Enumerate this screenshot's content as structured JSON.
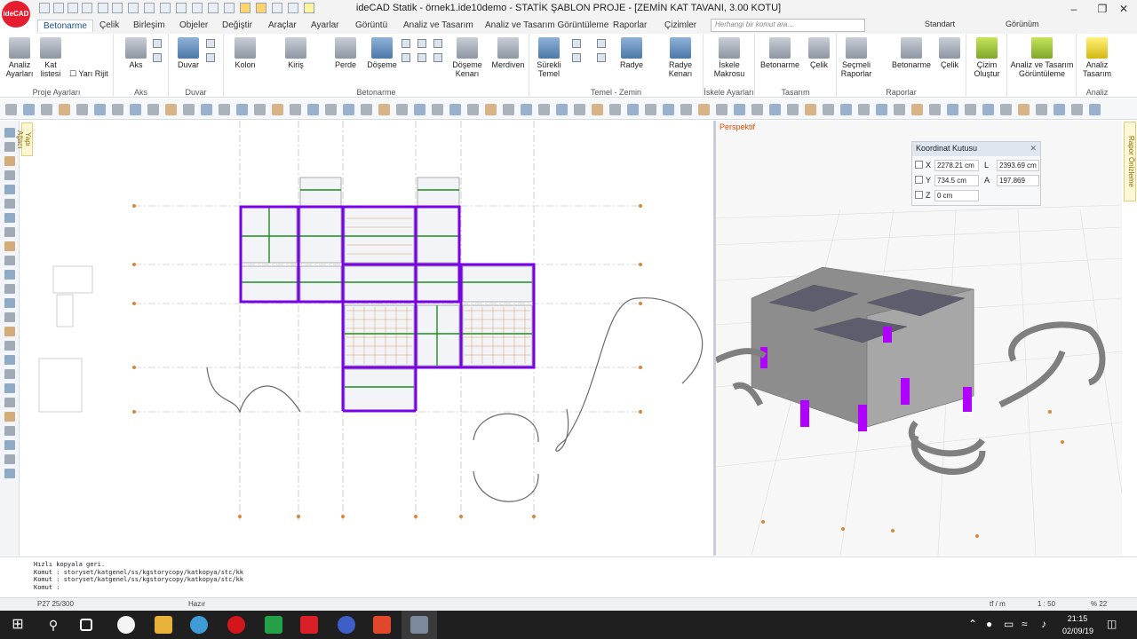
{
  "window": {
    "title": "ideCAD Statik - örnek1.ide10demo - STATİK ŞABLON PROJE - [ZEMİN KAT TAVANI,  3.00 KOTU]",
    "logo_text": "ideCAD"
  },
  "ribbon_tabs": [
    "Betonarme",
    "Çelik",
    "Birleşim",
    "Objeler",
    "Değiştir",
    "Araçlar",
    "Ayarlar",
    "Görüntü",
    "Analiz ve Tasarım",
    "Analiz ve Tasarım Görüntüleme",
    "Raporlar",
    "Çizimler"
  ],
  "active_tab": "Betonarme",
  "command_search": {
    "placeholder": "Herhangi bir komut ara..."
  },
  "style_select": "Standart",
  "view_menu": "Görünüm",
  "ribbon": {
    "groups": [
      {
        "label": "Proje Ayarları",
        "buttons": [
          "Analiz Ayarları",
          "Kat listesi",
          "Yarı Rijit"
        ]
      },
      {
        "label": "Aks",
        "buttons": [
          "Aks"
        ]
      },
      {
        "label": "Duvar",
        "buttons": [
          "Duvar"
        ]
      },
      {
        "label": "Betonarme",
        "buttons": [
          "Kolon",
          "Kiriş",
          "Perde",
          "Döşeme",
          "Döşeme Kenarı",
          "Merdiven"
        ]
      },
      {
        "label": "Temel - Zemin",
        "buttons": [
          "Sürekli Temel",
          "Radye",
          "Radye Kenarı"
        ]
      },
      {
        "label": "İskele Ayarları",
        "buttons": [
          "İskele Makrosu"
        ]
      },
      {
        "label": "Tasarım",
        "buttons": [
          "Betonarme",
          "Çelik"
        ]
      },
      {
        "label": "Raporlar",
        "buttons": [
          "Seçmeli Raporlar",
          "Betonarme",
          "Çelik"
        ]
      },
      {
        "label": "",
        "buttons": [
          "Çizim Oluştur"
        ]
      },
      {
        "label": "",
        "buttons": [
          "Analiz ve Tasarım Görüntüleme"
        ]
      },
      {
        "label": "Analiz",
        "buttons": [
          "Analiz Tasarım"
        ]
      }
    ]
  },
  "left_tabs": {
    "project_tree": "Yapı Ağacı",
    "report_preview": "Rapor Önizleme"
  },
  "perspective": {
    "label": "Perspektif"
  },
  "coordinate_box": {
    "title": "Koordinat Kutusu",
    "x_label": "X",
    "x_value": "2278.21 cm",
    "y_label": "Y",
    "y_value": "734.5 cm",
    "z_label": "Z",
    "z_value": "0 cm",
    "l_label": "L",
    "l_value": "2393.69 cm",
    "a_label": "A",
    "a_value": "197.869"
  },
  "command_log": [
    "Hızlı kopyala geri.",
    "Komut : storyset/katgenel/ss/kgstorycopy/katkopya/stc/kk",
    "Komut : storyset/katgenel/ss/kgstorycopy/katkopya/stc/kk",
    "Komut :"
  ],
  "status_bar": {
    "coord": "P27 25/300",
    "state": "Hazır",
    "units": "tf / m",
    "scale": "1 : 50",
    "zoom": "% 22"
  },
  "taskbar": {
    "time": "21:15",
    "date": "02/09/19"
  },
  "colors": {
    "accent": "#1a4f8b",
    "column_purple": "#8a00ff",
    "beam_green": "#1e8c1e",
    "grid_orange": "#d6883a",
    "logo_red": "#e51d2e"
  }
}
